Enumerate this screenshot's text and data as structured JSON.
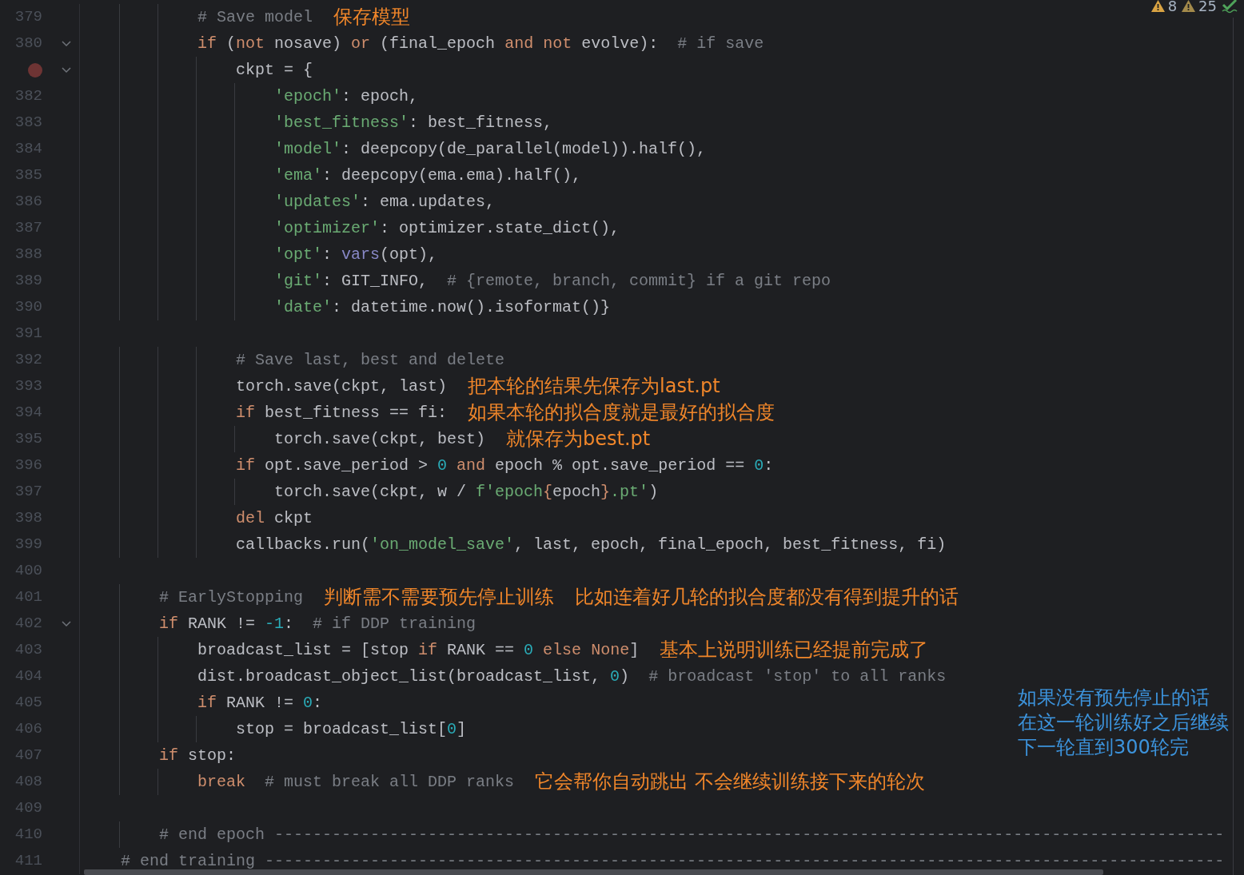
{
  "editor": {
    "inspections": [
      {
        "kind": "warning",
        "count": "8"
      },
      {
        "kind": "weak_warning",
        "count": "25"
      }
    ],
    "lines": [
      {
        "number": "379",
        "foldable": false,
        "breakpoint": false,
        "tokens": [
          {
            "kind": "cmt",
            "text": "            # Save model"
          },
          {
            "kind": "note",
            "text": "保存模型"
          }
        ]
      },
      {
        "number": "380",
        "foldable": true,
        "breakpoint": false,
        "tokens": [
          {
            "kind": "kw",
            "text": "            if"
          },
          {
            "kind": "plain",
            "text": " ("
          },
          {
            "kind": "kw",
            "text": "not"
          },
          {
            "kind": "plain",
            "text": " nosave) "
          },
          {
            "kind": "kw",
            "text": "or"
          },
          {
            "kind": "plain",
            "text": " (final_epoch "
          },
          {
            "kind": "kw",
            "text": "and"
          },
          {
            "kind": "kw",
            "text": " not"
          },
          {
            "kind": "plain",
            "text": " evolve):  "
          },
          {
            "kind": "cmt",
            "text": "# if save"
          }
        ]
      },
      {
        "foldable": true,
        "breakpoint": true,
        "tokens": [
          {
            "kind": "plain",
            "text": "                ckpt = {"
          }
        ]
      },
      {
        "number": "382",
        "foldable": false,
        "breakpoint": false,
        "tokens": [
          {
            "kind": "str",
            "text": "                    'epoch'"
          },
          {
            "kind": "plain",
            "text": ": epoch,"
          }
        ]
      },
      {
        "number": "383",
        "foldable": false,
        "breakpoint": false,
        "tokens": [
          {
            "kind": "str",
            "text": "                    'best_fitness'"
          },
          {
            "kind": "plain",
            "text": ": best_fitness,"
          }
        ]
      },
      {
        "number": "384",
        "foldable": false,
        "breakpoint": false,
        "tokens": [
          {
            "kind": "str",
            "text": "                    'model'"
          },
          {
            "kind": "plain",
            "text": ": deepcopy(de_parallel(model)).half(),"
          }
        ]
      },
      {
        "number": "385",
        "foldable": false,
        "breakpoint": false,
        "tokens": [
          {
            "kind": "str",
            "text": "                    'ema'"
          },
          {
            "kind": "plain",
            "text": ": deepcopy(ema.ema).half(),"
          }
        ]
      },
      {
        "number": "386",
        "foldable": false,
        "breakpoint": false,
        "tokens": [
          {
            "kind": "str",
            "text": "                    'updates'"
          },
          {
            "kind": "plain",
            "text": ": ema.updates,"
          }
        ]
      },
      {
        "number": "387",
        "foldable": false,
        "breakpoint": false,
        "tokens": [
          {
            "kind": "str",
            "text": "                    'optimizer'"
          },
          {
            "kind": "plain",
            "text": ": optimizer.state_dict(),"
          }
        ]
      },
      {
        "number": "388",
        "foldable": false,
        "breakpoint": false,
        "tokens": [
          {
            "kind": "str",
            "text": "                    'opt'"
          },
          {
            "kind": "plain",
            "text": ": "
          },
          {
            "kind": "builtin",
            "text": "vars"
          },
          {
            "kind": "plain",
            "text": "(opt),"
          }
        ]
      },
      {
        "number": "389",
        "foldable": false,
        "breakpoint": false,
        "tokens": [
          {
            "kind": "str",
            "text": "                    'git'"
          },
          {
            "kind": "plain",
            "text": ": GIT_INFO,  "
          },
          {
            "kind": "cmt",
            "text": "# {remote, branch, commit} if a git repo"
          }
        ]
      },
      {
        "number": "390",
        "foldable": false,
        "breakpoint": false,
        "tokens": [
          {
            "kind": "str",
            "text": "                    'date'"
          },
          {
            "kind": "plain",
            "text": ": datetime.now().isoformat()}"
          }
        ]
      },
      {
        "number": "391",
        "foldable": false,
        "breakpoint": false
      },
      {
        "number": "392",
        "foldable": false,
        "breakpoint": false,
        "tokens": [
          {
            "kind": "cmt",
            "text": "                # Save last, best and delete"
          }
        ]
      },
      {
        "number": "393",
        "foldable": false,
        "breakpoint": false,
        "tokens": [
          {
            "kind": "plain",
            "text": "                torch.save(ckpt, last)"
          },
          {
            "kind": "note",
            "text": "把本轮的结果先保存为last.pt"
          }
        ]
      },
      {
        "number": "394",
        "foldable": false,
        "breakpoint": false,
        "tokens": [
          {
            "kind": "kw",
            "text": "                if"
          },
          {
            "kind": "plain",
            "text": " best_fitness == fi:"
          },
          {
            "kind": "note",
            "text": "如果本轮的拟合度就是最好的拟合度"
          }
        ]
      },
      {
        "number": "395",
        "foldable": false,
        "breakpoint": false,
        "tokens": [
          {
            "kind": "plain",
            "text": "                    torch.save(ckpt, best)"
          },
          {
            "kind": "note",
            "text": "就保存为best.pt"
          }
        ]
      },
      {
        "number": "396",
        "foldable": false,
        "breakpoint": false,
        "tokens": [
          {
            "kind": "kw",
            "text": "                if"
          },
          {
            "kind": "plain",
            "text": " opt.save_period > "
          },
          {
            "kind": "num",
            "text": "0"
          },
          {
            "kind": "kw",
            "text": " and"
          },
          {
            "kind": "plain",
            "text": " epoch % opt.save_period == "
          },
          {
            "kind": "num",
            "text": "0"
          },
          {
            "kind": "plain",
            "text": ":"
          }
        ]
      },
      {
        "number": "397",
        "foldable": false,
        "breakpoint": false,
        "tokens": [
          {
            "kind": "plain",
            "text": "                    torch.save(ckpt, w / "
          },
          {
            "kind": "str",
            "text": "f'epoch"
          },
          {
            "kind": "kw",
            "text": "{"
          },
          {
            "kind": "plain",
            "text": "epoch"
          },
          {
            "kind": "kw",
            "text": "}"
          },
          {
            "kind": "str",
            "text": ".pt'"
          },
          {
            "kind": "plain",
            "text": ")"
          }
        ]
      },
      {
        "number": "398",
        "foldable": false,
        "breakpoint": false,
        "tokens": [
          {
            "kind": "kw",
            "text": "                del"
          },
          {
            "kind": "plain",
            "text": " ckpt"
          }
        ]
      },
      {
        "number": "399",
        "foldable": false,
        "breakpoint": false,
        "tokens": [
          {
            "kind": "plain",
            "text": "                callbacks.run("
          },
          {
            "kind": "str",
            "text": "'on_model_save'"
          },
          {
            "kind": "plain",
            "text": ", last, epoch, final_epoch, best_fitness, fi)"
          }
        ]
      },
      {
        "number": "400",
        "foldable": false,
        "breakpoint": false
      },
      {
        "number": "401",
        "foldable": false,
        "breakpoint": false,
        "tokens": [
          {
            "kind": "cmt",
            "text": "        # EarlyStopping"
          },
          {
            "kind": "note",
            "text": "判断需不需要预先停止训练"
          },
          {
            "kind": "note",
            "text": "比如连着好几轮的拟合度都没有得到提升的话"
          }
        ]
      },
      {
        "number": "402",
        "foldable": true,
        "breakpoint": false,
        "tokens": [
          {
            "kind": "kw",
            "text": "        if"
          },
          {
            "kind": "plain",
            "text": " RANK != "
          },
          {
            "kind": "num",
            "text": "-1"
          },
          {
            "kind": "plain",
            "text": ":  "
          },
          {
            "kind": "cmt",
            "text": "# if DDP training"
          }
        ]
      },
      {
        "number": "403",
        "foldable": false,
        "breakpoint": false,
        "tokens": [
          {
            "kind": "plain",
            "text": "            broadcast_list = [stop "
          },
          {
            "kind": "kw",
            "text": "if"
          },
          {
            "kind": "plain",
            "text": " RANK == "
          },
          {
            "kind": "num",
            "text": "0"
          },
          {
            "kind": "kw",
            "text": " else"
          },
          {
            "kind": "kw",
            "text": " None"
          },
          {
            "kind": "plain",
            "text": "]"
          },
          {
            "kind": "note",
            "text": "基本上说明训练已经提前完成了"
          }
        ]
      },
      {
        "number": "404",
        "foldable": false,
        "breakpoint": false,
        "tokens": [
          {
            "kind": "plain",
            "text": "            dist.broadcast_object_list(broadcast_list, "
          },
          {
            "kind": "num",
            "text": "0"
          },
          {
            "kind": "plain",
            "text": ")  "
          },
          {
            "kind": "cmt",
            "text": "# broadcast 'stop' to all ranks"
          }
        ]
      },
      {
        "number": "405",
        "foldable": false,
        "breakpoint": false,
        "tokens": [
          {
            "kind": "kw",
            "text": "            if"
          },
          {
            "kind": "plain",
            "text": " RANK != "
          },
          {
            "kind": "num",
            "text": "0"
          },
          {
            "kind": "plain",
            "text": ":"
          }
        ]
      },
      {
        "number": "406",
        "foldable": false,
        "breakpoint": false,
        "tokens": [
          {
            "kind": "plain",
            "text": "                stop = broadcast_list["
          },
          {
            "kind": "num",
            "text": "0"
          },
          {
            "kind": "plain",
            "text": "]"
          }
        ]
      },
      {
        "number": "407",
        "foldable": false,
        "breakpoint": false,
        "tokens": [
          {
            "kind": "kw",
            "text": "        if"
          },
          {
            "kind": "plain",
            "text": " stop:"
          }
        ]
      },
      {
        "number": "408",
        "foldable": false,
        "breakpoint": false,
        "tokens": [
          {
            "kind": "kw",
            "text": "            break"
          },
          {
            "kind": "cmt",
            "text": "  # must break all DDP ranks"
          },
          {
            "kind": "note",
            "text": "它会帮你自动跳出 不会继续训练接下来的轮次"
          }
        ]
      },
      {
        "number": "409",
        "foldable": false,
        "breakpoint": false
      },
      {
        "number": "410",
        "foldable": false,
        "breakpoint": false,
        "tokens": [
          {
            "kind": "cmt",
            "text": "        # end epoch ---------------------------------------------------------------------------------------------------"
          }
        ]
      },
      {
        "number": "411",
        "foldable": false,
        "breakpoint": false,
        "tokens": [
          {
            "kind": "cmt",
            "text": "    # end training ----------------------------------------------------------------------------------------------------"
          }
        ]
      }
    ],
    "side_note": [
      "如果没有预先停止的话",
      "在这一轮训练好之后继续",
      "下一轮直到300轮完"
    ]
  }
}
